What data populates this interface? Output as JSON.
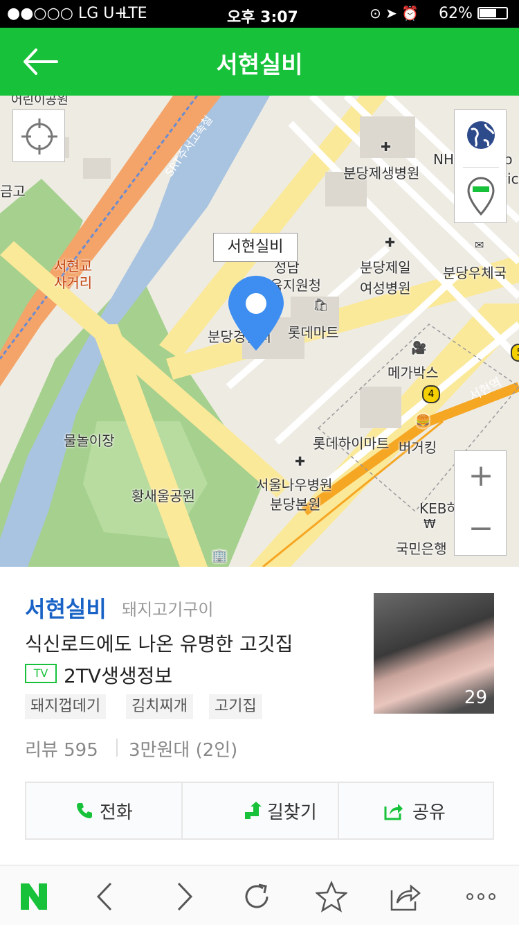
{
  "status": {
    "carrier": "●●○○○ LG U+",
    "network": "LTE",
    "time": "오후 3:07",
    "battery": "62%"
  },
  "header": {
    "title": "서현실비"
  },
  "map": {
    "callout": "서현실비",
    "labels": {
      "hospital1": "분당제생병원",
      "nhn": "NHNTechno",
      "nhn2": "Services",
      "hospital2a": "분당제일",
      "hospital2b": "여성병원",
      "post": "분당우체국",
      "seohyeon_a": "서현교",
      "seohyeon_b": "사거리",
      "office_a": "성남",
      "office_b": "교육지원청",
      "police": "분당경찰서",
      "lotte": "롯데마트",
      "mega": "메가박스",
      "station": "서현역",
      "water": "물놀이장",
      "lottehi": "롯데하이마트",
      "burger": "버거킹",
      "park": "황새울공원",
      "seoulhosp_a": "서울나우병원",
      "seoulhosp_b": "분당본원",
      "keb": "KEB하나은행",
      "kookmin": "국민은행",
      "geumgo": "금고",
      "rail": "SRT수서고속철",
      "top": "어린이공원"
    }
  },
  "place": {
    "name": "서현실비",
    "category": "돼지고기구이",
    "description": "식신로드에도 나온 유명한 고깃집",
    "tv_badge": "TV",
    "tv_program": "2TV생생정보",
    "tags": [
      "돼지껍데기",
      "김치찌개",
      "고기집"
    ],
    "review": "리뷰 595",
    "price": "3만원대 (2인)",
    "photo_count": "29"
  },
  "actions": {
    "call": "전화",
    "directions": "길찾기",
    "share": "공유"
  },
  "colors": {
    "brand": "#17c23a",
    "name": "#1a63c6"
  }
}
